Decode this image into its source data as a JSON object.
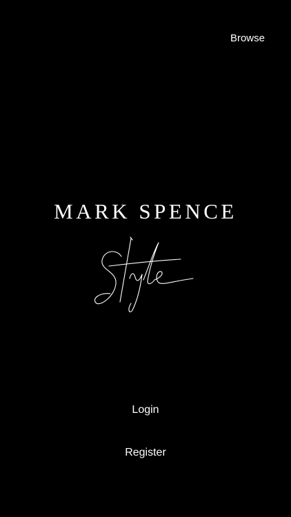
{
  "header": {
    "browse_label": "Browse"
  },
  "brand": {
    "name": "MARK SPENCE",
    "script_word": "Style"
  },
  "actions": {
    "login_label": "Login",
    "register_label": "Register"
  },
  "colors": {
    "background": "#000000",
    "text": "#ffffff"
  }
}
